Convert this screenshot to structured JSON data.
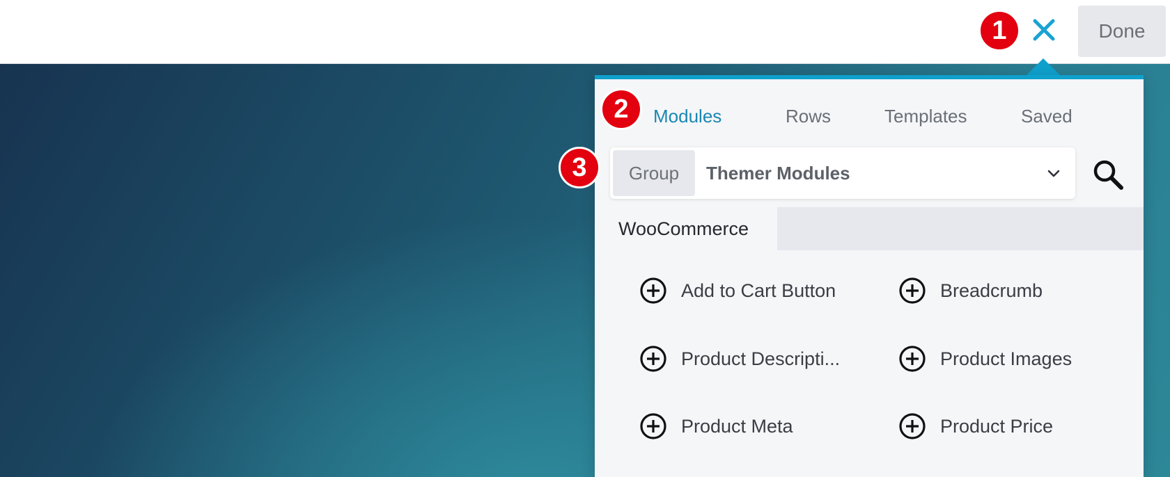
{
  "topbar": {
    "close_icon": "close-x-icon",
    "done_label": "Done"
  },
  "panel": {
    "tabs": [
      {
        "label": "Modules",
        "active": true
      },
      {
        "label": "Rows",
        "active": false
      },
      {
        "label": "Templates",
        "active": false
      },
      {
        "label": "Saved",
        "active": false
      }
    ],
    "group": {
      "label": "Group",
      "value": "Themer Modules"
    },
    "section": {
      "label": "WooCommerce"
    },
    "modules": [
      {
        "label": "Add to Cart Button"
      },
      {
        "label": "Breadcrumb"
      },
      {
        "label": "Product Descripti..."
      },
      {
        "label": "Product Images"
      },
      {
        "label": "Product Meta"
      },
      {
        "label": "Product Price"
      }
    ]
  },
  "callouts": [
    "1",
    "2",
    "3"
  ],
  "colors": {
    "accent": "#0fa0cc",
    "active_tab": "#1a87b2",
    "badge": "#e3000f"
  }
}
